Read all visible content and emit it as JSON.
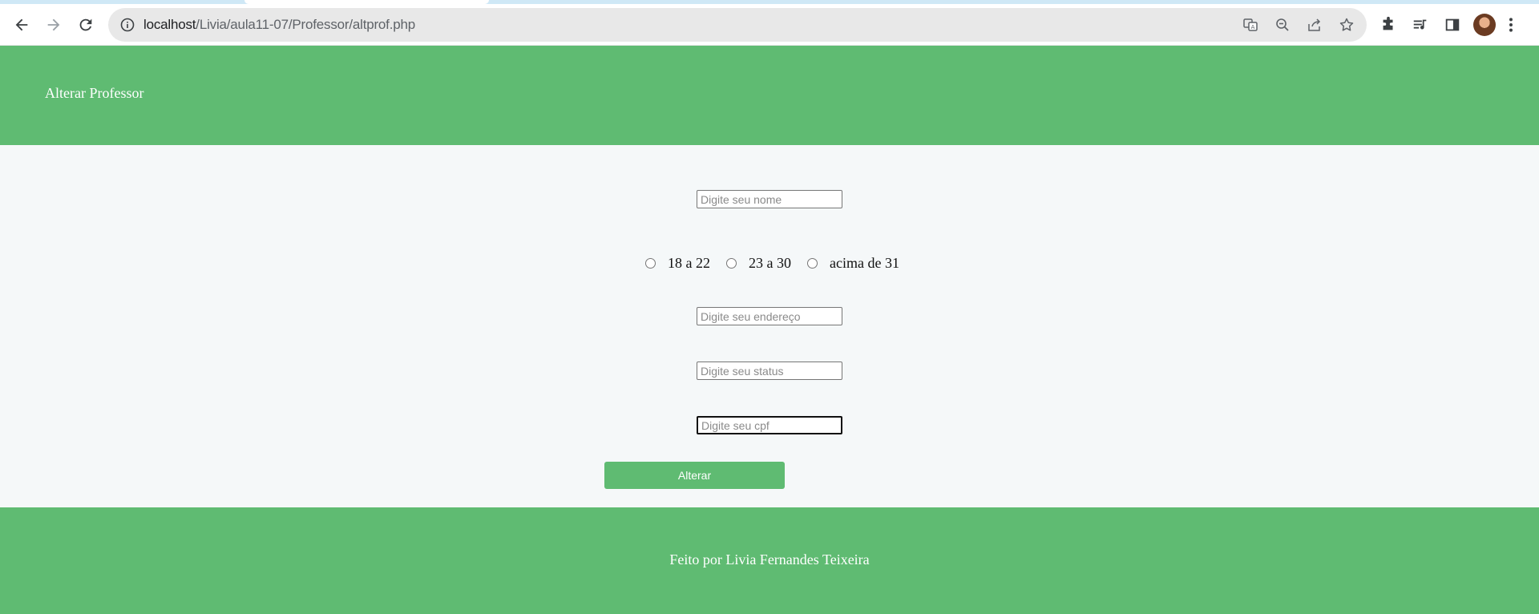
{
  "browser": {
    "url_host": "localhost",
    "url_path": "/Livia/aula11-07/Professor/altprof.php"
  },
  "header": {
    "title": "Alterar Professor"
  },
  "form": {
    "nome_placeholder": "Digite seu nome",
    "age_options": [
      "18 a 22",
      "23 a 30",
      "acima de 31"
    ],
    "endereco_placeholder": "Digite seu endereço",
    "status_placeholder": "Digite seu status",
    "cpf_placeholder": "Digite seu cpf",
    "submit_label": "Alterar"
  },
  "footer": {
    "text": "Feito por Livia Fernandes Teixeira"
  },
  "colors": {
    "accent": "#5fbb72",
    "background": "#f5f8f9"
  },
  "icons": [
    "back-icon",
    "forward-icon",
    "reload-icon",
    "site-info-icon",
    "translate-icon",
    "zoom-out-icon",
    "share-icon",
    "bookmark-star-icon",
    "extensions-icon",
    "media-controls-icon",
    "side-panel-icon",
    "profile-avatar",
    "menu-kebab-icon"
  ]
}
